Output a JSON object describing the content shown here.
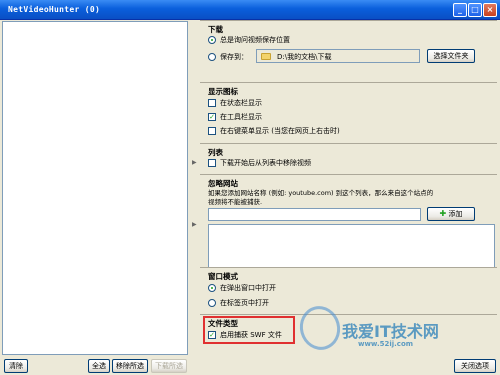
{
  "window": {
    "title": "NetVideoHunter (0)",
    "minimize": "_",
    "maximize": "□",
    "close": "×"
  },
  "download": {
    "header": "下载",
    "always_ask": "总是询问视频保存位置",
    "save_to": "保存到：",
    "path": "D:\\我的文档\\下载",
    "choose_folder": "选择文件夹"
  },
  "display_icon": {
    "header": "显示图标",
    "items": [
      {
        "label": "在状态栏显示",
        "checked": false
      },
      {
        "label": "在工具栏显示",
        "checked": true
      },
      {
        "label": "在右键菜单显示 (当您在网页上右击时)",
        "checked": false
      }
    ]
  },
  "list": {
    "header": "列表",
    "remove_after": "下载开始后从列表中移除视频"
  },
  "ignore_sites": {
    "header": "忽略网站",
    "description_line1": "如果您添加网站名称 (例如: youtube.com) 到这个列表，那么来自这个站点的",
    "description_line2": "视频将不能被捕获.",
    "add_label": "添加",
    "input_value": ""
  },
  "window_mode": {
    "header": "窗口模式",
    "popup": "在弹出窗口中打开",
    "tab": "在标签页中打开"
  },
  "file_type": {
    "header": "文件类型",
    "enable_swf": "启用捕获 SWF 文件"
  },
  "bottom": {
    "clear": "清除",
    "select_all": "全选",
    "remove_selected": "移除所选",
    "download_selected": "下载所选",
    "close_options": "关闭选项"
  },
  "watermark": {
    "main": "我爱IT技术网",
    "url": "www.52ij.com"
  },
  "colors": {
    "accent": "#0a5fdc",
    "highlight_border": "#e03030"
  }
}
